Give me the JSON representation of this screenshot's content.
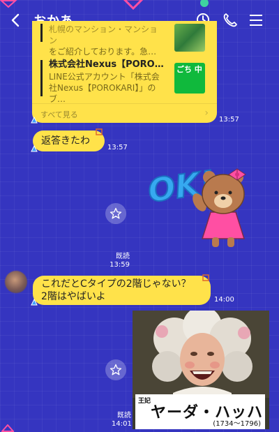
{
  "header": {
    "title": "おかあ",
    "icons": [
      "back-icon",
      "keep-search-icon",
      "phone-icon",
      "menu-icon"
    ]
  },
  "card": {
    "items": [
      {
        "title": "",
        "desc_line1": "札幌のマンション・マンション",
        "desc_line2": "をご紹介しております。急…"
      },
      {
        "title": "株式会社Nexus【POROKARI】…",
        "desc_line1": "LINE公式アカウント「株式会",
        "desc_line2": "社Nexus【POROKARI】」のブ…"
      }
    ],
    "thumb2_text": "ごち 中",
    "see_all": "すべて見る"
  },
  "messages": [
    {
      "ts": "13:57"
    },
    {
      "text": "返答きたわ",
      "ts": "13:57"
    },
    {
      "sticker_text": "OK!",
      "read": "既読",
      "ts": "13:59"
    },
    {
      "text_line1": "これだとCタイプの2階じゃない？",
      "text_line2": "2階はやばいよ",
      "ts": "14:00"
    },
    {
      "photo_caption_small": "王妃",
      "photo_caption": "ヤーダ・ハッハー",
      "photo_caption_years": "(1734〜1796)",
      "read": "既読",
      "ts": "14:01"
    }
  ],
  "colors": {
    "background": "#3535c0",
    "bubble": "#ffe24a",
    "accent_pink": "#ff4fa3"
  }
}
